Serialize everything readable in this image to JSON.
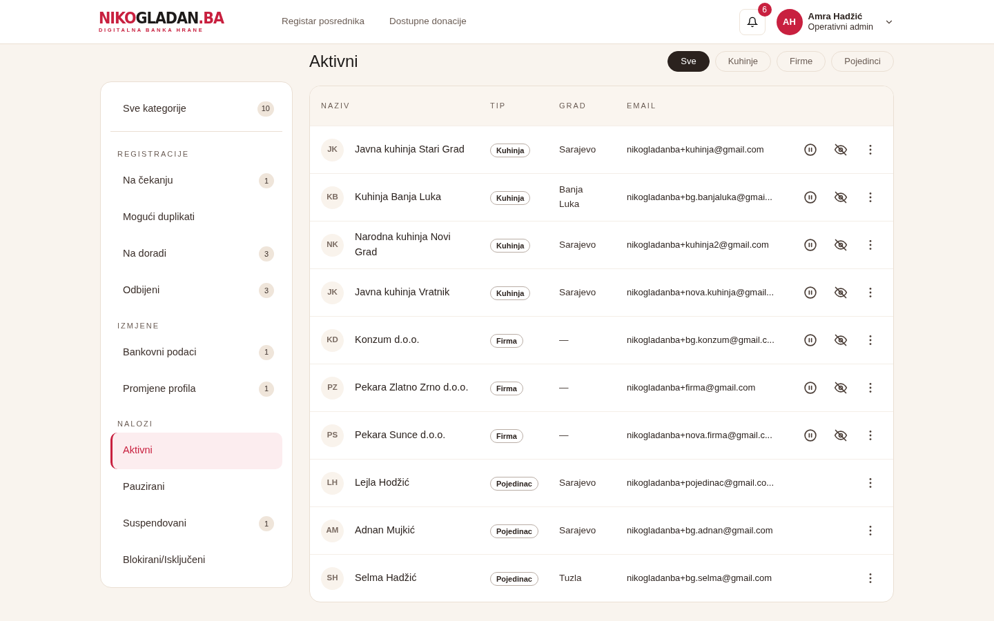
{
  "header": {
    "logo": {
      "parts": [
        {
          "text": "NIKO",
          "accent": true
        },
        {
          "text": "GLADAN",
          "accent": false
        },
        {
          "text": ".BA",
          "accent": true
        }
      ],
      "tagline": "DIGITALNA BANKA HRANE"
    },
    "nav": [
      "Registar posrednika",
      "Dostupne donacije"
    ],
    "notifications": {
      "count": "6"
    },
    "user": {
      "initials": "AH",
      "name": "Amra Hadžić",
      "role": "Operativni admin"
    }
  },
  "page": {
    "title": "Aktivni",
    "filters": [
      {
        "label": "Sve",
        "selected": true
      },
      {
        "label": "Kuhinje",
        "selected": false
      },
      {
        "label": "Firme",
        "selected": false
      },
      {
        "label": "Pojedinci",
        "selected": false
      }
    ]
  },
  "sidebar": {
    "all": {
      "label": "Sve kategorije",
      "count": "10",
      "selected": false
    },
    "sections": [
      {
        "heading": "REGISTRACIJE",
        "items": [
          {
            "label": "Na čekanju",
            "count": "1",
            "selected": false
          },
          {
            "label": "Mogući duplikati",
            "selected": false
          },
          {
            "label": "Na doradi",
            "count": "3",
            "selected": false
          },
          {
            "label": "Odbijeni",
            "count": "3",
            "selected": false
          }
        ]
      },
      {
        "heading": "IZMJENE",
        "items": [
          {
            "label": "Bankovni podaci",
            "count": "1",
            "selected": false
          },
          {
            "label": "Promjene profila",
            "count": "1",
            "selected": false
          }
        ]
      },
      {
        "heading": "NALOZI",
        "items": [
          {
            "label": "Aktivni",
            "selected": true
          },
          {
            "label": "Pauzirani",
            "selected": false
          },
          {
            "label": "Suspendovani",
            "count": "1",
            "selected": false
          },
          {
            "label": "Blokirani/Isključeni",
            "selected": false
          }
        ]
      }
    ]
  },
  "table": {
    "columns": [
      "NAZIV",
      "TIP",
      "GRAD",
      "EMAIL"
    ],
    "rows": [
      {
        "initials": "JK",
        "name": "Javna kuhinja Stari Grad",
        "type": "Kuhinja",
        "city": "Sarajevo",
        "email": "nikogladanba+kuhinja@gmail.com",
        "status_actions": true
      },
      {
        "initials": "KB",
        "name": "Kuhinja Banja Luka",
        "type": "Kuhinja",
        "city": "Banja Luka",
        "email": "nikogladanba+bg.banjaluka@gmai...",
        "status_actions": true
      },
      {
        "initials": "NK",
        "name": "Narodna kuhinja Novi Grad",
        "type": "Kuhinja",
        "city": "Sarajevo",
        "email": "nikogladanba+kuhinja2@gmail.com",
        "status_actions": true
      },
      {
        "initials": "JK",
        "name": "Javna kuhinja Vratnik",
        "type": "Kuhinja",
        "city": "Sarajevo",
        "email": "nikogladanba+nova.kuhinja@gmail...",
        "status_actions": true
      },
      {
        "initials": "KD",
        "name": "Konzum d.o.o.",
        "type": "Firma",
        "city": "—",
        "email": "nikogladanba+bg.konzum@gmail.c...",
        "status_actions": true
      },
      {
        "initials": "PZ",
        "name": "Pekara Zlatno Zrno d.o.o.",
        "type": "Firma",
        "city": "—",
        "email": "nikogladanba+firma@gmail.com",
        "status_actions": true
      },
      {
        "initials": "PS",
        "name": "Pekara Sunce d.o.o.",
        "type": "Firma",
        "city": "—",
        "email": "nikogladanba+nova.firma@gmail.c...",
        "status_actions": true
      },
      {
        "initials": "LH",
        "name": "Lejla Hodžić",
        "type": "Pojedinac",
        "city": "Sarajevo",
        "email": "nikogladanba+pojedinac@gmail.co...",
        "status_actions": false
      },
      {
        "initials": "AM",
        "name": "Adnan Mujkić",
        "type": "Pojedinac",
        "city": "Sarajevo",
        "email": "nikogladanba+bg.adnan@gmail.com",
        "status_actions": false
      },
      {
        "initials": "SH",
        "name": "Selma Hadžić",
        "type": "Pojedinac",
        "city": "Tuzla",
        "email": "nikogladanba+bg.selma@gmail.com",
        "status_actions": false
      }
    ]
  }
}
